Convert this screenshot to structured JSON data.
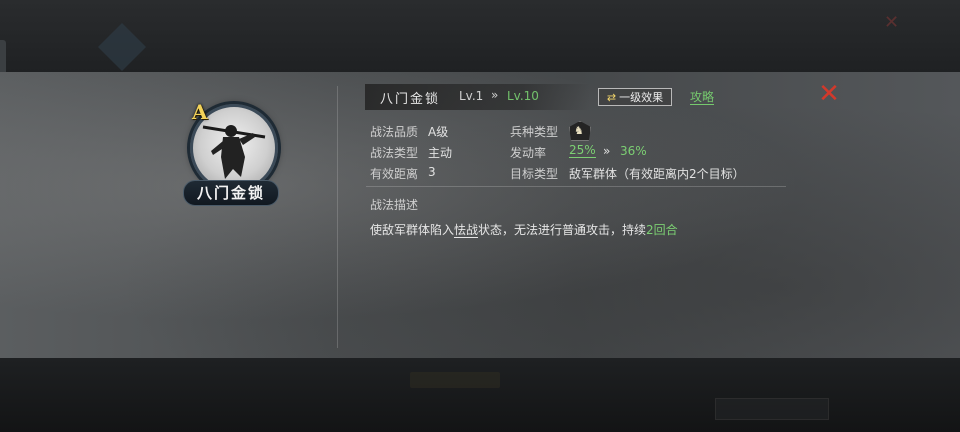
{
  "skill": {
    "name": "八门金锁",
    "grade": "A",
    "level_current": "Lv.1",
    "level_arrow": "»",
    "level_max": "Lv.10"
  },
  "header": {
    "effect_button_icon": "⇄",
    "effect_button_label": "一级效果",
    "strategy_link": "攻略",
    "close_icon": "close-x-icon"
  },
  "attributes": {
    "quality_label": "战法品质",
    "quality_value": "A级",
    "type_label": "战法类型",
    "type_value": "主动",
    "range_label": "有效距离",
    "range_value": "3",
    "troop_label": "兵种类型",
    "troop_icon": "horse-cavalry-icon",
    "rate_label": "发动率",
    "rate_current": "25%",
    "rate_arrow": "»",
    "rate_max": "36%",
    "target_label": "目标类型",
    "target_value": "敌军群体（有效距离内2个目标）"
  },
  "description": {
    "title": "战法描述",
    "text_before": "使敌军群体陷入",
    "keyword": "怯战",
    "text_middle": "状态，无法进行普通攻击，持续",
    "duration": "2回合"
  },
  "colors": {
    "accent_green": "#7ccf73",
    "close_red": "#d2392b",
    "grade_gold": "#f3d35a"
  }
}
